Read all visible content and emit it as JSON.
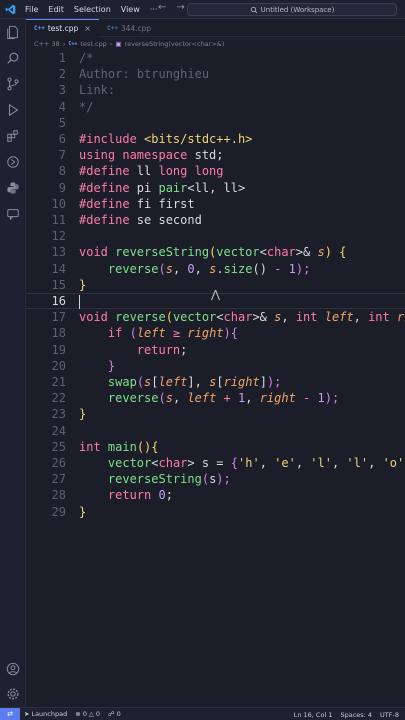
{
  "titlebar": {
    "menu": [
      "File",
      "Edit",
      "Selection",
      "View"
    ],
    "more": "···",
    "back_icon": "arrow-left-icon",
    "forward_icon": "arrow-right-icon",
    "search_text": "Untitled (Workspace)"
  },
  "tabs": [
    {
      "label": "test.cpp",
      "lang": "C++",
      "active": true
    },
    {
      "label": "344.cpp",
      "lang": "C++",
      "active": false
    }
  ],
  "breadcrumb": {
    "parts": [
      "C++ 38",
      "test.cpp",
      "reverseString(vector<char>&)"
    ]
  },
  "editor": {
    "current_line": 16,
    "lines": [
      {
        "n": "1",
        "tokens": [
          [
            "/*",
            "cmt"
          ]
        ]
      },
      {
        "n": "2",
        "tokens": [
          [
            "Author: btrunghieu",
            "cmt"
          ]
        ]
      },
      {
        "n": "3",
        "tokens": [
          [
            "Link:",
            "cmt"
          ]
        ]
      },
      {
        "n": "4",
        "tokens": [
          [
            "*/",
            "cmt"
          ]
        ]
      },
      {
        "n": "5",
        "tokens": []
      },
      {
        "n": "6",
        "tokens": [
          [
            "#include ",
            "kw"
          ],
          [
            "<bits/stdc++.h>",
            "str"
          ]
        ]
      },
      {
        "n": "7",
        "tokens": [
          [
            "using namespace ",
            "kw"
          ],
          [
            "std",
            "pl"
          ],
          [
            ";",
            "pl"
          ]
        ]
      },
      {
        "n": "8",
        "tokens": [
          [
            "#define ",
            "kw"
          ],
          [
            "ll ",
            "pl"
          ],
          [
            "long long",
            "kw"
          ]
        ]
      },
      {
        "n": "9",
        "tokens": [
          [
            "#define ",
            "kw"
          ],
          [
            "pi ",
            "pl"
          ],
          [
            "pair",
            "fn"
          ],
          [
            "<ll, ll>",
            "pl"
          ]
        ]
      },
      {
        "n": "10",
        "tokens": [
          [
            "#define ",
            "kw"
          ],
          [
            "fi ",
            "pl"
          ],
          [
            "first",
            "pl"
          ]
        ]
      },
      {
        "n": "11",
        "tokens": [
          [
            "#define ",
            "kw"
          ],
          [
            "se ",
            "pl"
          ],
          [
            "second",
            "pl"
          ]
        ]
      },
      {
        "n": "12",
        "tokens": []
      },
      {
        "n": "13",
        "tokens": [
          [
            "void ",
            "kw"
          ],
          [
            "reverseString",
            "fn"
          ],
          [
            "(",
            "br"
          ],
          [
            "vector",
            "fn"
          ],
          [
            "<",
            "pl"
          ],
          [
            "char",
            "kw"
          ],
          [
            ">& ",
            "pl"
          ],
          [
            "s",
            "var"
          ],
          [
            ") ",
            "br"
          ],
          [
            "{",
            "br"
          ]
        ]
      },
      {
        "n": "14",
        "tokens": [
          [
            "    ",
            "pl"
          ],
          [
            "reverse",
            "fn"
          ],
          [
            "(",
            "br2"
          ],
          [
            "s",
            "var"
          ],
          [
            ", ",
            "pl"
          ],
          [
            "0",
            "num"
          ],
          [
            ", ",
            "pl"
          ],
          [
            "s",
            "var"
          ],
          [
            ".",
            "pl"
          ],
          [
            "size",
            "fn"
          ],
          [
            "()",
            "pl"
          ],
          [
            " - ",
            "kw"
          ],
          [
            "1",
            "num"
          ],
          [
            ");",
            "br2"
          ]
        ]
      },
      {
        "n": "15",
        "tokens": [
          [
            "}",
            "br"
          ]
        ]
      },
      {
        "n": "16",
        "tokens": []
      },
      {
        "n": "17",
        "tokens": [
          [
            "void ",
            "kw"
          ],
          [
            "reverse",
            "fn"
          ],
          [
            "(",
            "br"
          ],
          [
            "vector",
            "fn"
          ],
          [
            "<",
            "pl"
          ],
          [
            "char",
            "kw"
          ],
          [
            ">& ",
            "pl"
          ],
          [
            "s",
            "var"
          ],
          [
            ", ",
            "pl"
          ],
          [
            "int ",
            "kw"
          ],
          [
            "left",
            "var"
          ],
          [
            ", ",
            "pl"
          ],
          [
            "int ",
            "kw"
          ],
          [
            "right",
            "var"
          ]
        ]
      },
      {
        "n": "18",
        "tokens": [
          [
            "    ",
            "pl"
          ],
          [
            "if ",
            "kw"
          ],
          [
            "(",
            "br2"
          ],
          [
            "left",
            "var"
          ],
          [
            " ≥ ",
            "kw"
          ],
          [
            "right",
            "var"
          ],
          [
            ")",
            "br2"
          ],
          [
            "{",
            "br2"
          ]
        ]
      },
      {
        "n": "19",
        "tokens": [
          [
            "        ",
            "pl"
          ],
          [
            "return",
            "kw"
          ],
          [
            ";",
            "pl"
          ]
        ]
      },
      {
        "n": "20",
        "tokens": [
          [
            "    ",
            "pl"
          ],
          [
            "}",
            "br2"
          ]
        ]
      },
      {
        "n": "21",
        "tokens": [
          [
            "    ",
            "pl"
          ],
          [
            "swap",
            "fn"
          ],
          [
            "(",
            "br2"
          ],
          [
            "s",
            "var"
          ],
          [
            "[",
            "pl"
          ],
          [
            "left",
            "var"
          ],
          [
            "], ",
            "pl"
          ],
          [
            "s",
            "var"
          ],
          [
            "[",
            "pl"
          ],
          [
            "right",
            "var"
          ],
          [
            "]",
            "pl"
          ],
          [
            ");",
            "br2"
          ]
        ]
      },
      {
        "n": "22",
        "tokens": [
          [
            "    ",
            "pl"
          ],
          [
            "reverse",
            "fn"
          ],
          [
            "(",
            "br2"
          ],
          [
            "s",
            "var"
          ],
          [
            ", ",
            "pl"
          ],
          [
            "left",
            "var"
          ],
          [
            " + ",
            "kw"
          ],
          [
            "1",
            "num"
          ],
          [
            ", ",
            "pl"
          ],
          [
            "right",
            "var"
          ],
          [
            " - ",
            "kw"
          ],
          [
            "1",
            "num"
          ],
          [
            ");",
            "br2"
          ]
        ]
      },
      {
        "n": "23",
        "tokens": [
          [
            "}",
            "br"
          ]
        ]
      },
      {
        "n": "24",
        "tokens": []
      },
      {
        "n": "25",
        "tokens": [
          [
            "int ",
            "kw"
          ],
          [
            "main",
            "fn"
          ],
          [
            "()",
            "br"
          ],
          [
            "{",
            "br"
          ]
        ]
      },
      {
        "n": "26",
        "tokens": [
          [
            "    ",
            "pl"
          ],
          [
            "vector",
            "fn"
          ],
          [
            "<",
            "pl"
          ],
          [
            "char",
            "kw"
          ],
          [
            "> s = ",
            "pl"
          ],
          [
            "{",
            "br2"
          ],
          [
            "'h'",
            "str"
          ],
          [
            ", ",
            "pl"
          ],
          [
            "'e'",
            "str"
          ],
          [
            ", ",
            "pl"
          ],
          [
            "'l'",
            "str"
          ],
          [
            ", ",
            "pl"
          ],
          [
            "'l'",
            "str"
          ],
          [
            ", ",
            "pl"
          ],
          [
            "'o'",
            "str"
          ]
        ]
      },
      {
        "n": "27",
        "tokens": [
          [
            "    ",
            "pl"
          ],
          [
            "reverseString",
            "fn"
          ],
          [
            "(",
            "br2"
          ],
          [
            "s",
            "pl"
          ],
          [
            ");",
            "br2"
          ]
        ]
      },
      {
        "n": "28",
        "tokens": [
          [
            "    ",
            "pl"
          ],
          [
            "return ",
            "kw"
          ],
          [
            "0",
            "num"
          ],
          [
            ";",
            "pl"
          ]
        ]
      },
      {
        "n": "29",
        "tokens": [
          [
            "}",
            "br"
          ]
        ]
      }
    ]
  },
  "statusbar": {
    "launchpad": "Launchpad",
    "errors": "0",
    "warnings": "0",
    "ports": "0",
    "position": "Ln 16, Col 1",
    "spaces": "Spaces: 4",
    "encoding": "UTF-8"
  },
  "activity_icons": [
    "explorer-icon",
    "search-icon",
    "source-control-icon",
    "run-debug-icon",
    "extensions-icon",
    "remote-explorer-icon",
    "python-icon",
    "chat-icon"
  ],
  "colors": {
    "background": "#1b1e28",
    "accent": "#5a7cf0",
    "keyword": "#ff7aa8",
    "function": "#7de08a",
    "variable": "#f2a46a",
    "number": "#c59cff",
    "string": "#f0d475",
    "comment": "#5d6378"
  }
}
